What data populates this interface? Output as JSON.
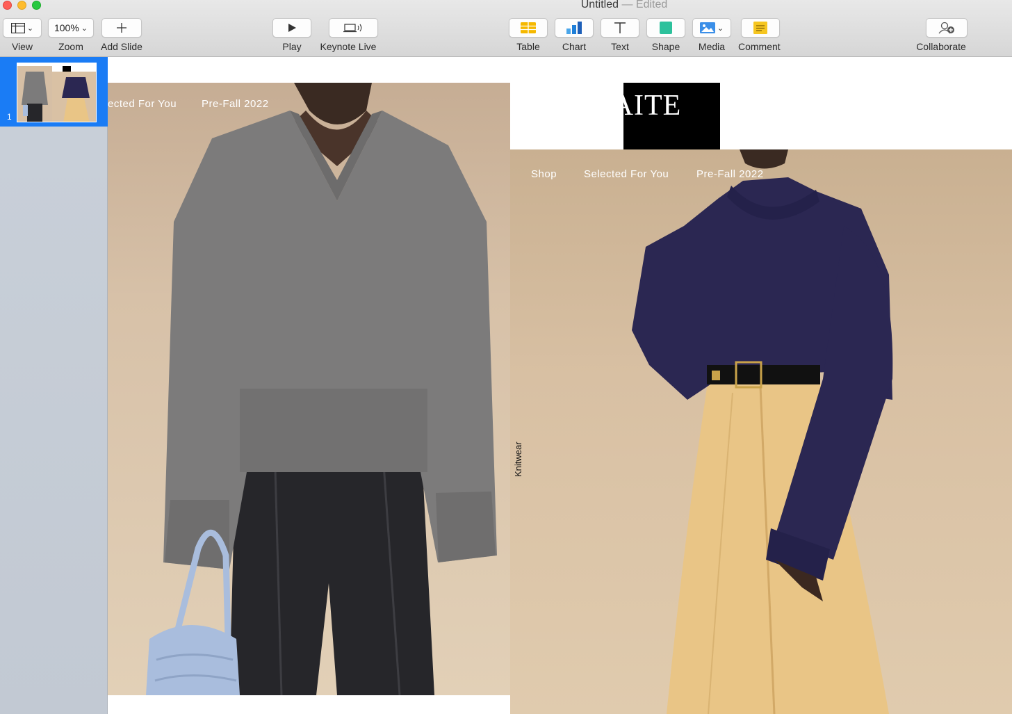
{
  "window": {
    "title": "Untitled",
    "separator": "—",
    "status": "Edited"
  },
  "toolbar": {
    "view_label": "View",
    "zoom_value": "100%",
    "zoom_label": "Zoom",
    "add_slide_label": "Add Slide",
    "play_label": "Play",
    "keynote_live_label": "Keynote Live",
    "table_label": "Table",
    "chart_label": "Chart",
    "text_label": "Text",
    "shape_label": "Shape",
    "media_label": "Media",
    "comment_label": "Comment",
    "collaborate_label": "Collaborate"
  },
  "navigator": {
    "slides": [
      {
        "number": "1",
        "selected": true
      }
    ]
  },
  "slide": {
    "image1": {
      "nav_items": [
        "ected For You",
        "Pre-Fall 2022"
      ]
    },
    "logo": "KHAITE",
    "image2": {
      "nav_items": [
        "Shop",
        "Selected For You",
        "Pre-Fall 2022"
      ],
      "side_label": "Knitwear"
    }
  },
  "colors": {
    "selection": "#1a7cf5",
    "sidebar": "#c6cdd6",
    "backdrop": "#d9c3a8",
    "grey_sweater": "#7c7b7b",
    "navy_sweater": "#2b2752",
    "yellow_skirt": "#e9c586",
    "leather": "#26262a",
    "bag": "#a9bddd"
  }
}
